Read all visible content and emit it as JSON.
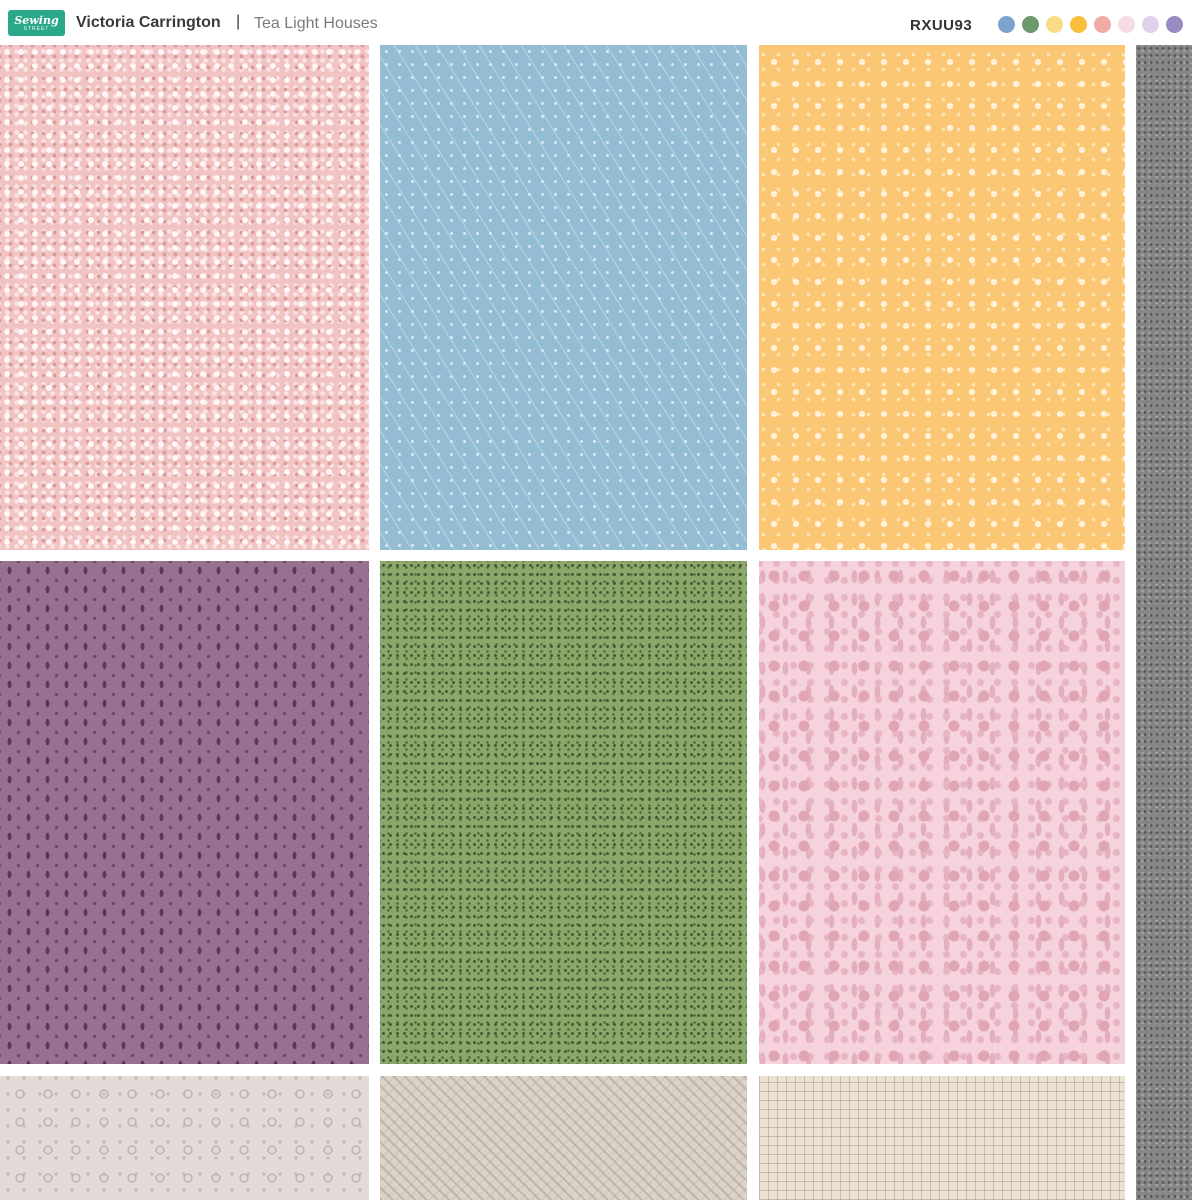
{
  "header": {
    "logo_line1": "Sewing",
    "logo_line2": "STREET",
    "designer": "Victoria Carrington",
    "separator": "|",
    "collection": "Tea Light Houses",
    "code": "RXUU93"
  },
  "palette": [
    "#7da2cc",
    "#6a9a6e",
    "#f9dd86",
    "#f7bf3c",
    "#f0aca4",
    "#f6dde4",
    "#e1d2ec",
    "#9b89c2"
  ],
  "fabrics": [
    {
      "name": "pink-blossom",
      "color": "#f1c3c3"
    },
    {
      "name": "blue-fern",
      "color": "#94bdd3"
    },
    {
      "name": "yellow-dot",
      "color": "#fcc774"
    },
    {
      "name": "purple-sprig",
      "color": "#987191"
    },
    {
      "name": "green-speckle",
      "color": "#8ba86a"
    },
    {
      "name": "pink-floral",
      "color": "#f6d2dc"
    },
    {
      "name": "grey-ring",
      "color": "#e2dbd8"
    },
    {
      "name": "taupe-weave",
      "color": "#dbd3c8"
    },
    {
      "name": "cream-plaid",
      "color": "#ece2d3"
    },
    {
      "name": "grey-speckle-strip",
      "color": "#858585"
    }
  ]
}
